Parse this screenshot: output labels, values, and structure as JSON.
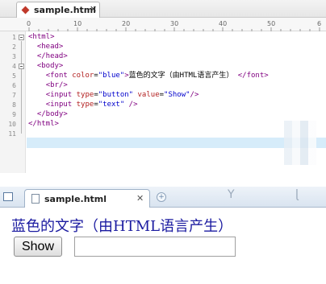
{
  "editor": {
    "tab_title": "sample.html",
    "tab_close": "✕",
    "ruler_ticks": [
      "0",
      "10",
      "20",
      "30",
      "40",
      "50",
      "6"
    ],
    "line_numbers": [
      "1",
      "2",
      "3",
      "4",
      "5",
      "6",
      "7",
      "8",
      "9",
      "10",
      "11"
    ],
    "code": {
      "l1_open": "<html>",
      "l2_head_open": "<head>",
      "l3_head_close": "</head>",
      "l4_body_open": "<body>",
      "l5_font_tag": "<font ",
      "l5_attr": "color",
      "l5_eq": "=",
      "l5_val": "\"blue\"",
      "l5_close_bracket": ">",
      "l5_text": "蓝色的文字（由HTML语言产生）",
      "l5_end": " </font>",
      "l6_br": "<br/>",
      "l7_input": "<input ",
      "l7_attr1": "type",
      "l7_val1": "\"button\"",
      "l7_attr2": "value",
      "l7_val2": "\"Show\"",
      "l7_end": "/>",
      "l8_input": "<input ",
      "l8_attr1": "type",
      "l8_val1": "\"text\"",
      "l8_end": " />",
      "l9_body_close": "</body>",
      "l10_html_close": "</html>"
    }
  },
  "browser": {
    "tab_title": "sample.html",
    "tab_close": "✕",
    "new_tab": "+",
    "page": {
      "blue_text": "蓝色的文字（由HTML语言产生）",
      "show_button_label": "Show",
      "text_input_value": ""
    }
  },
  "colors": {
    "tag": "#800080",
    "attribute": "#b21f1f",
    "attribute_value": "#0000cc",
    "font_blue": "#1a1aa0",
    "current_line": "#d6ecfa"
  }
}
